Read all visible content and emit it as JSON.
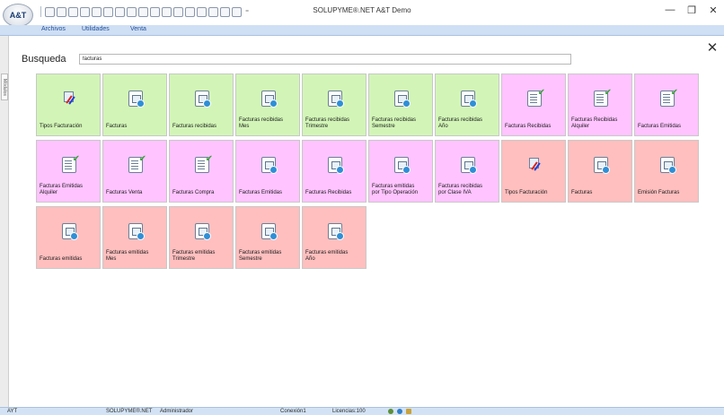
{
  "app": {
    "orb_label": "A&T",
    "window_title": "SOLUPYME®.NET A&T Demo",
    "minimize_glyph": "—",
    "maximize_glyph": "❐",
    "close_glyph": "✕",
    "qat_more": "⁼"
  },
  "menu": {
    "items": [
      "Archivos",
      "Utilidades",
      "Venta"
    ]
  },
  "side": {
    "tab_label": "Módulos"
  },
  "search": {
    "label": "Busqueda",
    "value": "facturas"
  },
  "close_glyph": "✕",
  "tiles": [
    {
      "label": "Tipos Facturación",
      "color": "#d2f5b7",
      "icon": "figure-icon"
    },
    {
      "label": "Facturas",
      "color": "#d2f5b7",
      "icon": "document-icon"
    },
    {
      "label": "Facturas recibidas",
      "color": "#d2f5b7",
      "icon": "document-icon"
    },
    {
      "label": "Facturas recibidas\nMes",
      "color": "#d2f5b7",
      "icon": "document-icon"
    },
    {
      "label": "Facturas recibidas\nTrimestre",
      "color": "#d2f5b7",
      "icon": "document-icon"
    },
    {
      "label": "Facturas recibidas\nSemestre",
      "color": "#d2f5b7",
      "icon": "document-icon"
    },
    {
      "label": "Facturas recibidas\nAño",
      "color": "#d2f5b7",
      "icon": "document-icon"
    },
    {
      "label": "Facturas Recibidas",
      "color": "#ffc4ff",
      "icon": "check-document-icon"
    },
    {
      "label": "Facturas Recibidas\nAlquiler",
      "color": "#ffc4ff",
      "icon": "check-document-icon"
    },
    {
      "label": "Facturas Emitidas",
      "color": "#ffc4ff",
      "icon": "check-document-icon"
    },
    {
      "label": "Facturas Emitidas\nAlquiler",
      "color": "#ffc4ff",
      "icon": "check-document-icon"
    },
    {
      "label": "Facturas Venta",
      "color": "#ffc4ff",
      "icon": "check-document-icon"
    },
    {
      "label": "Facturas Compra",
      "color": "#ffc4ff",
      "icon": "check-document-icon"
    },
    {
      "label": "Facturas Emitidas",
      "color": "#ffc4ff",
      "icon": "document-icon"
    },
    {
      "label": "Facturas Recibidas",
      "color": "#ffc4ff",
      "icon": "document-icon"
    },
    {
      "label": "Facturas emitidas\npor Tipo Operación",
      "color": "#ffc4ff",
      "icon": "document-icon"
    },
    {
      "label": "Facturas recibidas\npor Clase IVA",
      "color": "#ffc4ff",
      "icon": "document-icon"
    },
    {
      "label": "Tipos Facturación",
      "color": "#ffbfbf",
      "icon": "figure-icon"
    },
    {
      "label": "Facturas",
      "color": "#ffbfbf",
      "icon": "document-icon"
    },
    {
      "label": "Emisión Facturas",
      "color": "#ffbfbf",
      "icon": "document-icon"
    },
    {
      "label": "Facturas emitidas",
      "color": "#ffbfbf",
      "icon": "document-icon"
    },
    {
      "label": "Facturas emitidas\nMes",
      "color": "#ffbfbf",
      "icon": "document-icon"
    },
    {
      "label": "Facturas emitidas\nTrimestre",
      "color": "#ffbfbf",
      "icon": "document-icon"
    },
    {
      "label": "Facturas emitidas\nSemestre",
      "color": "#ffbfbf",
      "icon": "document-icon"
    },
    {
      "label": "Facturas emitidas\nAño",
      "color": "#ffbfbf",
      "icon": "document-icon"
    }
  ],
  "status": {
    "left": "AYT",
    "product": "SOLUPYME®.NET",
    "user": "Administrador",
    "connection": "Conexión1",
    "licenses": "Licencias:100"
  }
}
